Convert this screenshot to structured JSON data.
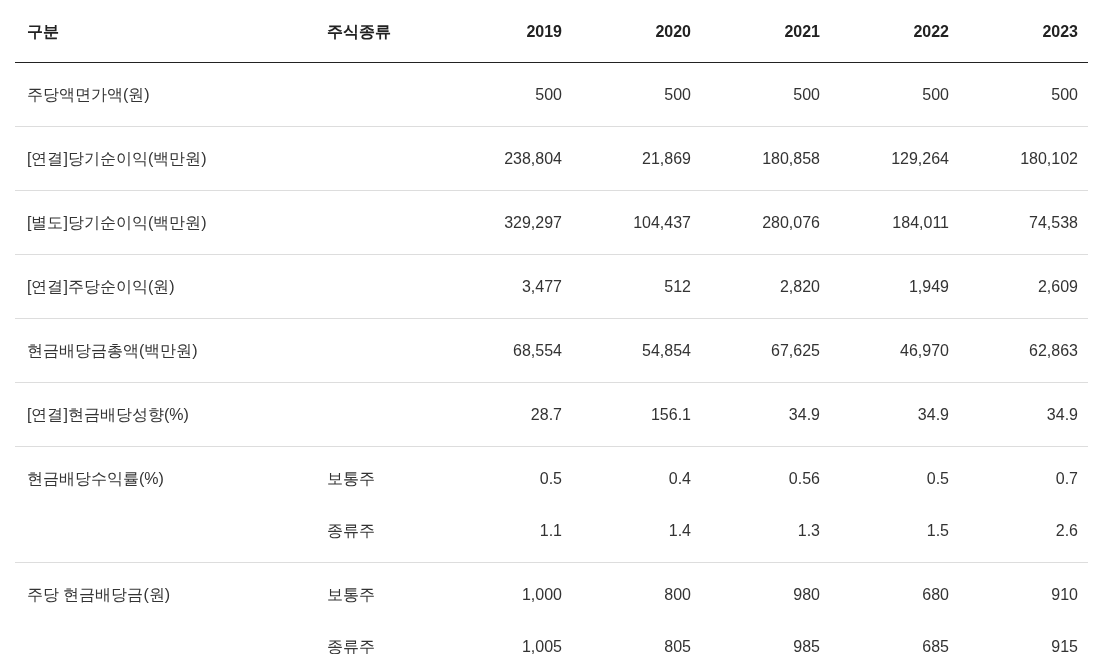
{
  "table": {
    "columns": [
      "구분",
      "주식종류",
      "2019",
      "2020",
      "2021",
      "2022",
      "2023"
    ],
    "rows": [
      {
        "label": "주당액면가액(원)",
        "sub_rows": [
          {
            "stock_type": "",
            "values": [
              "500",
              "500",
              "500",
              "500",
              "500"
            ]
          }
        ]
      },
      {
        "label": "[연결]당기순이익(백만원)",
        "sub_rows": [
          {
            "stock_type": "",
            "values": [
              "238,804",
              "21,869",
              "180,858",
              "129,264",
              "180,102"
            ]
          }
        ]
      },
      {
        "label": "[별도]당기순이익(백만원)",
        "sub_rows": [
          {
            "stock_type": "",
            "values": [
              "329,297",
              "104,437",
              "280,076",
              "184,011",
              "74,538"
            ]
          }
        ]
      },
      {
        "label": "[연결]주당순이익(원)",
        "sub_rows": [
          {
            "stock_type": "",
            "values": [
              "3,477",
              "512",
              "2,820",
              "1,949",
              "2,609"
            ]
          }
        ]
      },
      {
        "label": "현금배당금총액(백만원)",
        "sub_rows": [
          {
            "stock_type": "",
            "values": [
              "68,554",
              "54,854",
              "67,625",
              "46,970",
              "62,863"
            ]
          }
        ]
      },
      {
        "label": "[연결]현금배당성향(%)",
        "sub_rows": [
          {
            "stock_type": "",
            "values": [
              "28.7",
              "156.1",
              "34.9",
              "34.9",
              "34.9"
            ]
          }
        ]
      },
      {
        "label": "현금배당수익률(%)",
        "sub_rows": [
          {
            "stock_type": "보통주",
            "values": [
              "0.5",
              "0.4",
              "0.56",
              "0.5",
              "0.7"
            ]
          },
          {
            "stock_type": "종류주",
            "values": [
              "1.1",
              "1.4",
              "1.3",
              "1.5",
              "2.6"
            ]
          }
        ]
      },
      {
        "label": "주당 현금배당금(원)",
        "sub_rows": [
          {
            "stock_type": "보통주",
            "values": [
              "1,000",
              "800",
              "980",
              "680",
              "910"
            ]
          },
          {
            "stock_type": "종류주",
            "values": [
              "1,005",
              "805",
              "985",
              "685",
              "915"
            ]
          }
        ]
      }
    ]
  }
}
